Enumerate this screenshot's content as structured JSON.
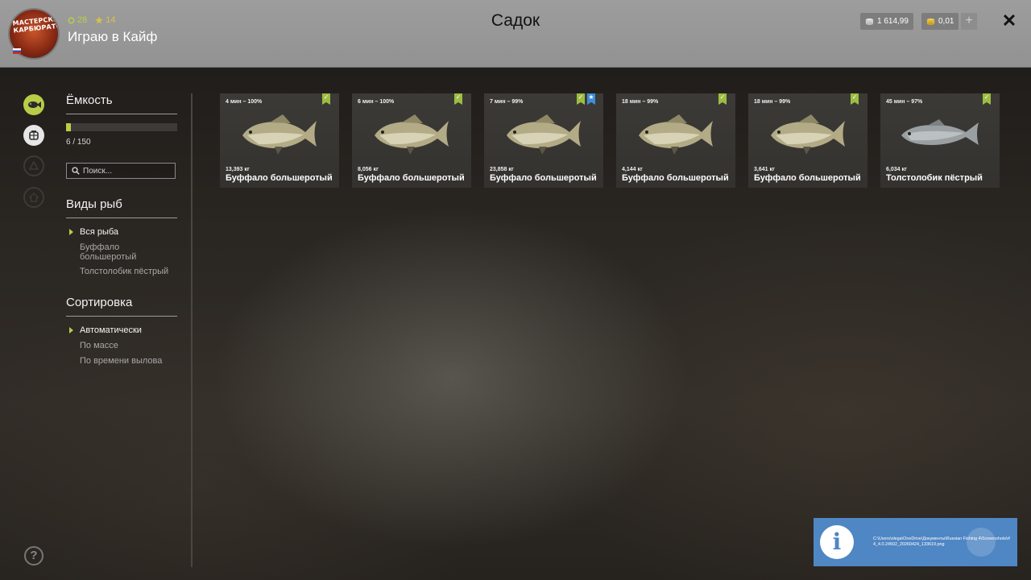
{
  "header": {
    "title": "Садок",
    "player_name": "Играю в Кайф",
    "rank": "28",
    "level": "14",
    "avatar_text": "МАСТЕРСКАЯ КАРБЮРАТОР",
    "silver": "1 614,99",
    "gold": "0,01",
    "add_label": "+",
    "close_label": "✕"
  },
  "sidebar": {
    "icons": [
      "fish-icon",
      "keepnet-icon",
      "tent-icon",
      "home-icon"
    ],
    "help_label": "?"
  },
  "filters": {
    "capacity_title": "Ёмкость",
    "capacity_text": "6 / 150",
    "capacity_fraction": 0.04,
    "search_placeholder": "Поиск...",
    "species_title": "Виды рыб",
    "species_options": [
      "Вся рыба",
      "Буффало большеротый",
      "Толстолобик пёстрый"
    ],
    "species_selected": 0,
    "sort_title": "Сортировка",
    "sort_options": [
      "Автоматически",
      "По массе",
      "По времени вылова"
    ],
    "sort_selected": 0
  },
  "fish_cards": [
    {
      "time": "4 мин – 100%",
      "weight": "13,393 кг",
      "name": "Буффало большеротый",
      "blue_badge": false
    },
    {
      "time": "6 мин – 100%",
      "weight": "8,056 кг",
      "name": "Буффало большеротый",
      "blue_badge": false
    },
    {
      "time": "7 мин – 99%",
      "weight": "23,858 кг",
      "name": "Буффало большеротый",
      "blue_badge": true
    },
    {
      "time": "18 мин – 99%",
      "weight": "4,144 кг",
      "name": "Буффало большеротый",
      "blue_badge": false
    },
    {
      "time": "18 мин – 99%",
      "weight": "3,641 кг",
      "name": "Буффало большеротый",
      "blue_badge": false
    },
    {
      "time": "45 мин – 97%",
      "weight": "6,034 кг",
      "name": "Толстолобик пёстрый",
      "blue_badge": false
    }
  ],
  "notification": {
    "icon_label": "i",
    "text": "C:\\Users\\olega\\OneDrive\\Документы\\Russian Fishing 4\\Screenshots\\rf4_4.0.24502_20260424_133619.png"
  },
  "colors": {
    "accent": "#b9cd45",
    "header_bg": "#999999",
    "toast_bg": "#4f86c4"
  }
}
